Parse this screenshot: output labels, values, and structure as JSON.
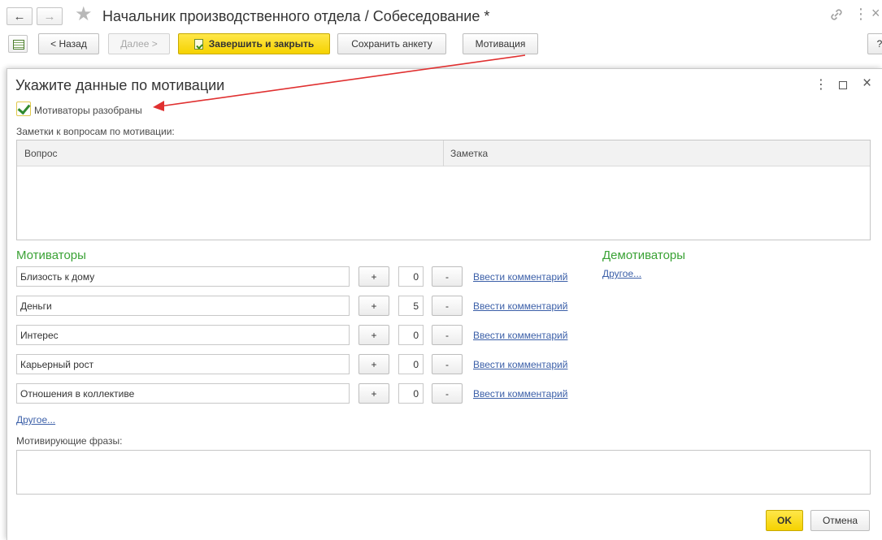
{
  "window": {
    "title": "Начальник производственного отдела / Собеседование *"
  },
  "toolbar": {
    "back_label": "< Назад",
    "next_label": "Далее >",
    "finish_label": "Завершить и закрыть",
    "save_label": "Сохранить анкету",
    "motivation_label": "Мотивация",
    "help_label": "?"
  },
  "dialog": {
    "title": "Укажите данные по мотивации",
    "checkbox_label": "Мотиваторы разобраны",
    "checkbox_checked": true,
    "notes_label": "Заметки к вопросам по мотивации:",
    "notes_columns": [
      "Вопрос",
      "Заметка"
    ],
    "motivators_title": "Мотиваторы",
    "demotivators_title": "Демотиваторы",
    "motivators": [
      {
        "name": "Близость к дому",
        "value": "0",
        "plus": "+",
        "minus": "-",
        "comment": "Ввести комментарий"
      },
      {
        "name": "Деньги",
        "value": "5",
        "plus": "+",
        "minus": "-",
        "comment": "Ввести комментарий"
      },
      {
        "name": "Интерес",
        "value": "0",
        "plus": "+",
        "minus": "-",
        "comment": "Ввести комментарий"
      },
      {
        "name": "Карьерный рост",
        "value": "0",
        "plus": "+",
        "minus": "-",
        "comment": "Ввести комментарий"
      },
      {
        "name": "Отношения в коллективе",
        "value": "0",
        "plus": "+",
        "minus": "-",
        "comment": "Ввести комментарий"
      }
    ],
    "motivators_other": "Другое...",
    "demotivators_other": "Другое...",
    "phrases_label": "Мотивирующие фразы:",
    "ok_label": "OK",
    "cancel_label": "Отмена"
  },
  "colors": {
    "accent_yellow": "#f5d200",
    "section_green": "#3aa235",
    "link_blue": "#3b5fa8",
    "annotation_arrow": "#e03030"
  }
}
